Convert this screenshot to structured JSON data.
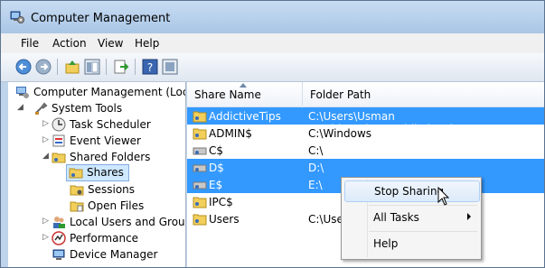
{
  "window": {
    "title": "Computer Management"
  },
  "menu": [
    "File",
    "Action",
    "View",
    "Help"
  ],
  "toolbar": {
    "buttons": [
      "back-icon",
      "forward-icon",
      "up-icon",
      "show-hide-tree-icon",
      "export-icon",
      "help-icon",
      "console-icon"
    ]
  },
  "tree": [
    {
      "label": "Computer Management (Local",
      "icon": "computer-management-icon"
    },
    {
      "label": "System Tools",
      "icon": "system-tools-icon"
    },
    {
      "label": "Task Scheduler",
      "icon": "clock-icon"
    },
    {
      "label": "Event Viewer",
      "icon": "event-viewer-icon"
    },
    {
      "label": "Shared Folders",
      "icon": "shared-folders-icon"
    },
    {
      "label": "Shares",
      "icon": "shares-icon"
    },
    {
      "label": "Sessions",
      "icon": "sessions-icon"
    },
    {
      "label": "Open Files",
      "icon": "open-files-icon"
    },
    {
      "label": "Local Users and Groups",
      "icon": "users-icon"
    },
    {
      "label": "Performance",
      "icon": "performance-icon"
    },
    {
      "label": "Device Manager",
      "icon": "device-manager-icon"
    }
  ],
  "list": {
    "columns": [
      "Share Name",
      "Folder Path"
    ],
    "rows": [
      {
        "name": "AddictiveTips",
        "path": "C:\\Users\\Usman Javaid\\Desktop\\AddictiveTips"
      },
      {
        "name": "ADMIN$",
        "path": "C:\\Windows"
      },
      {
        "name": "C$",
        "path": "C:\\"
      },
      {
        "name": "D$",
        "path": "D:\\"
      },
      {
        "name": "E$",
        "path": "E:\\"
      },
      {
        "name": "IPC$",
        "path": ""
      },
      {
        "name": "Users",
        "path": "C:\\Use"
      }
    ]
  },
  "context_menu": {
    "items": [
      "Stop Sharing",
      "All Tasks",
      "Help"
    ]
  },
  "colors": {
    "selection": "#3399ff",
    "title_bar": "#bfd4ea"
  }
}
